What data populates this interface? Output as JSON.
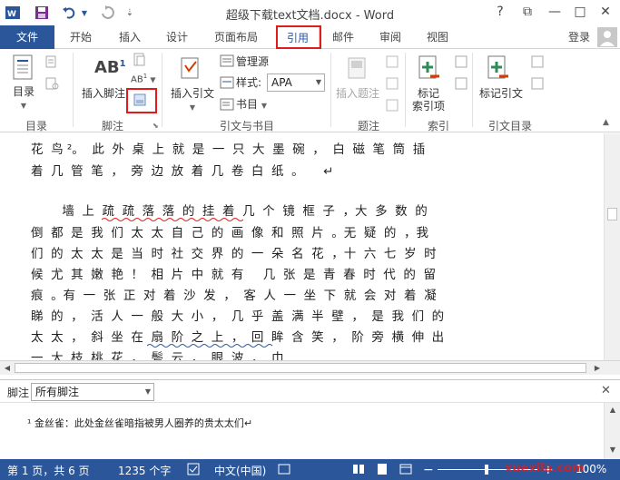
{
  "titlebar": {
    "title": "超级下载text文档.docx - Word",
    "help": "?",
    "ribbon_display": "⧉",
    "minimize": "—",
    "restore": "□",
    "close": "✕",
    "qat_word_icon": "word-logo-icon",
    "qat_save_icon": "save-icon",
    "qat_undo_icon": "undo-icon",
    "qat_redo_icon": "redo-icon",
    "qat_custom_icon": "customize-qat-icon"
  },
  "tabs": {
    "file": "文件",
    "home": "开始",
    "insert": "插入",
    "design": "设计",
    "layout": "页面布局",
    "references": "引用",
    "mailings": "邮件",
    "review": "审阅",
    "view": "视图",
    "signin": "登录"
  },
  "ribbon": {
    "toc": {
      "toc_button": "目录",
      "group_label": "目录"
    },
    "footnotes": {
      "insert_footnote": "插入脚注",
      "ab_label": "AB",
      "ab_sup": "1",
      "group_label": "脚注"
    },
    "citations": {
      "insert_citation": "插入引文",
      "manage_sources": "管理源",
      "style_label": "样式:",
      "style_value": "APA",
      "bibliography": "书目",
      "group_label": "引文与书目"
    },
    "captions": {
      "insert_caption": "插入题注",
      "group_label": "题注"
    },
    "index": {
      "mark_entry_line1": "标记",
      "mark_entry_line2": "索引项",
      "group_label": "索引"
    },
    "toa": {
      "mark_citation": "标记引文",
      "group_label": "引文目录"
    }
  },
  "document": {
    "lines": [
      "花  鸟 ²。  此  外  桌  上  就  是  一  只  大  墨  碗  ，  白  磁  笔  筒  插",
      "着  几  管  笔  ，  旁  边  放  着  几  卷  白  纸  。     ↵",
      "",
      "        墙  上  疏  疏  落  落  的  挂  着  几  个  镜  框  子  ，大  多  数  的",
      "倒  都  是  我  们  太  太  自  己  的  画  像  和  照  片  。无  疑  的  ，我",
      "们  的  太  太  是  当  时  社  交  界  的  一  朵  名  花  ，十  六  七  岁  时",
      "候  尤  其  嫩  艳  ！  相  片  中  就  有     几  张  是  青  春  时  代  的  留",
      "痕  。有  一  张  正  对  着  沙  发  ，  客  人  一  坐  下  就  会  对  着  凝",
      "睇  的  ，  活  人  一  般  大  小  ，  几  乎  盖  满  半  壁  ，  是  我  们  的",
      "太  太  ，  斜  坐  在  扇  阶  之  上  ，  回  眸  含  笑  ，  阶  旁  横  伸  出",
      "一  大  枝  桃  花  ，  鬓  云  ，  眼  波  ，  巾"
    ]
  },
  "footnote_pane": {
    "label": "脚注",
    "dropdown_value": "所有脚注",
    "close": "✕",
    "note_text": "¹ 金丝雀：此处金丝雀暗指被男人圈养的贵太太们↵"
  },
  "statusbar": {
    "page": "第 1 页，共 6 页",
    "words": "1235 个字",
    "language": "中文(中国)",
    "zoom": "100%",
    "watermark": "xuexila.com"
  }
}
